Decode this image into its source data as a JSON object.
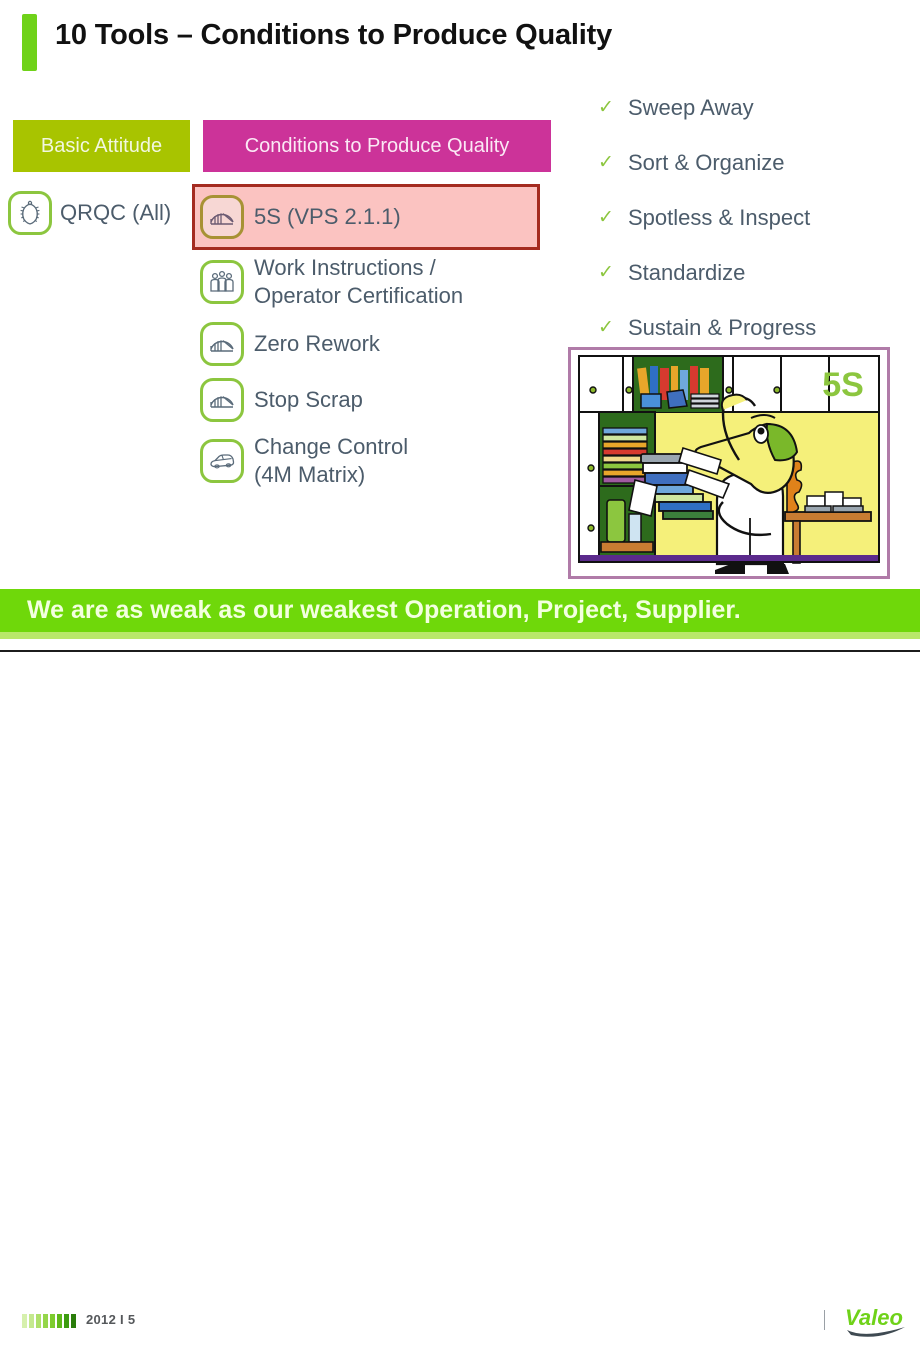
{
  "slide": {
    "title": "10 Tools – Conditions to Produce Quality",
    "accent_green": "#6fd219",
    "header_green": "#a8c400",
    "header_magenta": "#cc3399",
    "text_slate": "#4c5c6b",
    "highlight_bg": "#fbc3c1",
    "highlight_border": "#a42b20"
  },
  "columns": {
    "basic_attitude_header": "Basic Attitude",
    "conditions_header": "Conditions to Produce Quality"
  },
  "basic_attitude": {
    "items": [
      {
        "label": "QRQC (All)",
        "icon": "laurel-wreath-icon"
      }
    ]
  },
  "conditions": {
    "items": [
      {
        "label": "5S (VPS 2.1.1)",
        "icon": "bridge-icon",
        "highlighted": true
      },
      {
        "label_line1": "Work Instructions /",
        "label_line2": "Operator Certification",
        "icon": "three-people-icon",
        "highlighted": false
      },
      {
        "label": "Zero Rework",
        "icon": "bridge-icon",
        "highlighted": false
      },
      {
        "label": "Stop Scrap",
        "icon": "bridge-icon",
        "highlighted": false
      },
      {
        "label_line1": "Change Control",
        "label_line2": "(4M Matrix)",
        "icon": "car-icon",
        "highlighted": false
      }
    ]
  },
  "checklist": {
    "check_glyph": "✓",
    "check_color": "#8cc63f",
    "items": [
      {
        "label": "Sweep Away"
      },
      {
        "label": "Sort & Organize"
      },
      {
        "label": "Spotless & Inspect"
      },
      {
        "label": "Standardize"
      },
      {
        "label": "Sustain & Progress"
      }
    ]
  },
  "illustration": {
    "caption_text": "5S",
    "caption_color": "#8cc63f",
    "frame_color": "#b07ba8",
    "description": "cartoon worker carrying stack of files in front of shelves"
  },
  "banner": {
    "text": "We are as weak as our weakest Operation, Project, Supplier.",
    "background": "#6fd80a",
    "text_color": "#f3ffe0"
  },
  "footer": {
    "page_label": "2012 I 5",
    "separator": "|",
    "brand": "Valeo",
    "bar_colors": [
      "#d6f0ad",
      "#c4e98e",
      "#aee06a",
      "#95d64a",
      "#7dcc2e",
      "#5fb81a",
      "#3d9c10",
      "#2a7d0b"
    ]
  }
}
